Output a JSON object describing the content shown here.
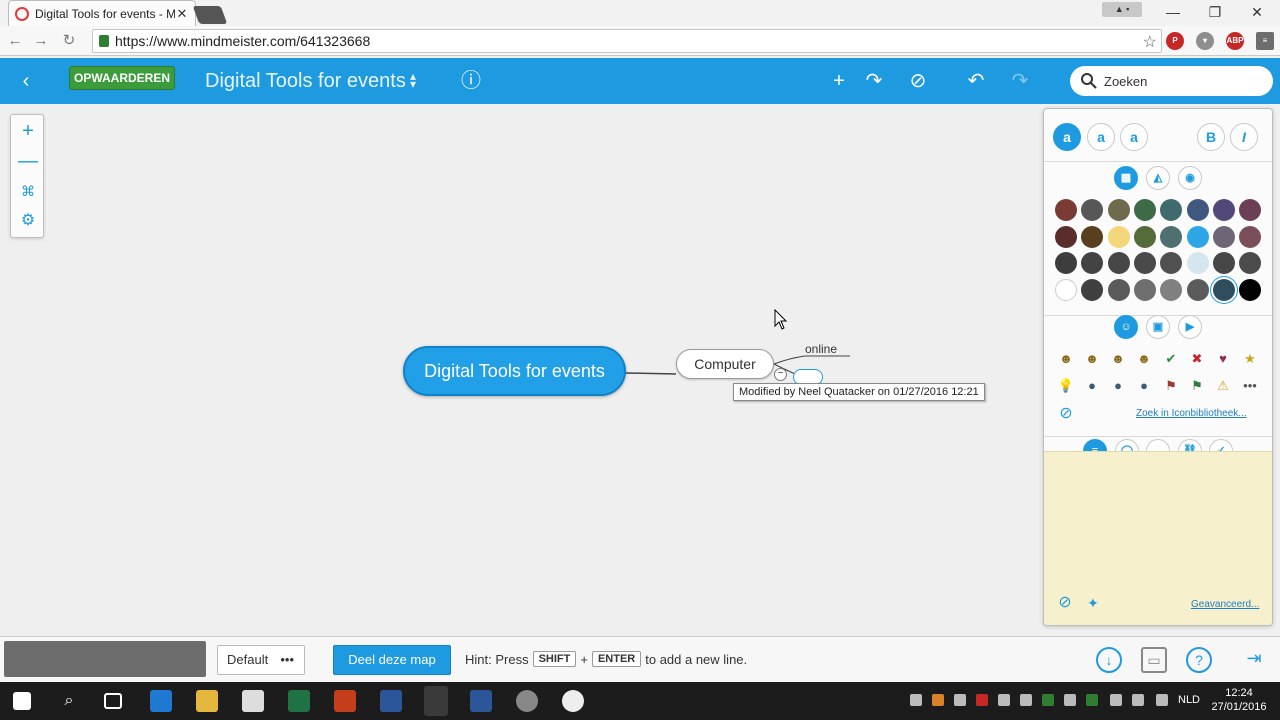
{
  "browser": {
    "tab_title": "Digital Tools for events - M",
    "url": "https://www.mindmeister.com/641323668"
  },
  "toolbar": {
    "upgrade_label": "OPWAARDEREN",
    "map_title": "Digital Tools for events",
    "search_placeholder": "Zoeken"
  },
  "mindmap": {
    "root": "Digital Tools for events",
    "child": "Computer",
    "grandchild": "online",
    "tooltip": "Modified by Neel Quatacker on 01/27/2016 12:21"
  },
  "panel": {
    "text_style_options": [
      "a",
      "a",
      "a"
    ],
    "bold_label": "B",
    "italic_label": "I",
    "color_rows": [
      [
        "#7a3b34",
        "#575757",
        "#6d6b4c",
        "#3e6b47",
        "#3f6b6e",
        "#3f587f",
        "#52487a",
        "#6b3f55"
      ],
      [
        "#5a2d2a",
        "#5a3f1f",
        "#f4d77a",
        "#556b3a",
        "#4f7070",
        "#2ea6e6",
        "#6e6677",
        "#7a4f5a"
      ],
      [
        "#3d3d3d",
        "#434343",
        "#464646",
        "#4a4a4a",
        "#505050",
        "#d6e6ee",
        "#474747",
        "#4b4b4b"
      ],
      [
        "#ffffff",
        "#3f3f3f",
        "#5a5a5a",
        "#6e6e6e",
        "#808080",
        "#5b5b5b",
        "#2e4e5e",
        "#000000"
      ]
    ],
    "icon_library_link": "Zoek in Iconbibliotheek...",
    "advanced_link": "Geavanceerd..."
  },
  "bottom": {
    "default_label": "Default",
    "share_label": "Deel deze map",
    "hint_prefix": "Hint: Press",
    "key_shift": "SHIFT",
    "plus": "+",
    "key_enter": "ENTER",
    "hint_suffix": "to add a new line."
  },
  "taskbar": {
    "language": "NLD",
    "time": "12:24",
    "date": "27/01/2016"
  }
}
